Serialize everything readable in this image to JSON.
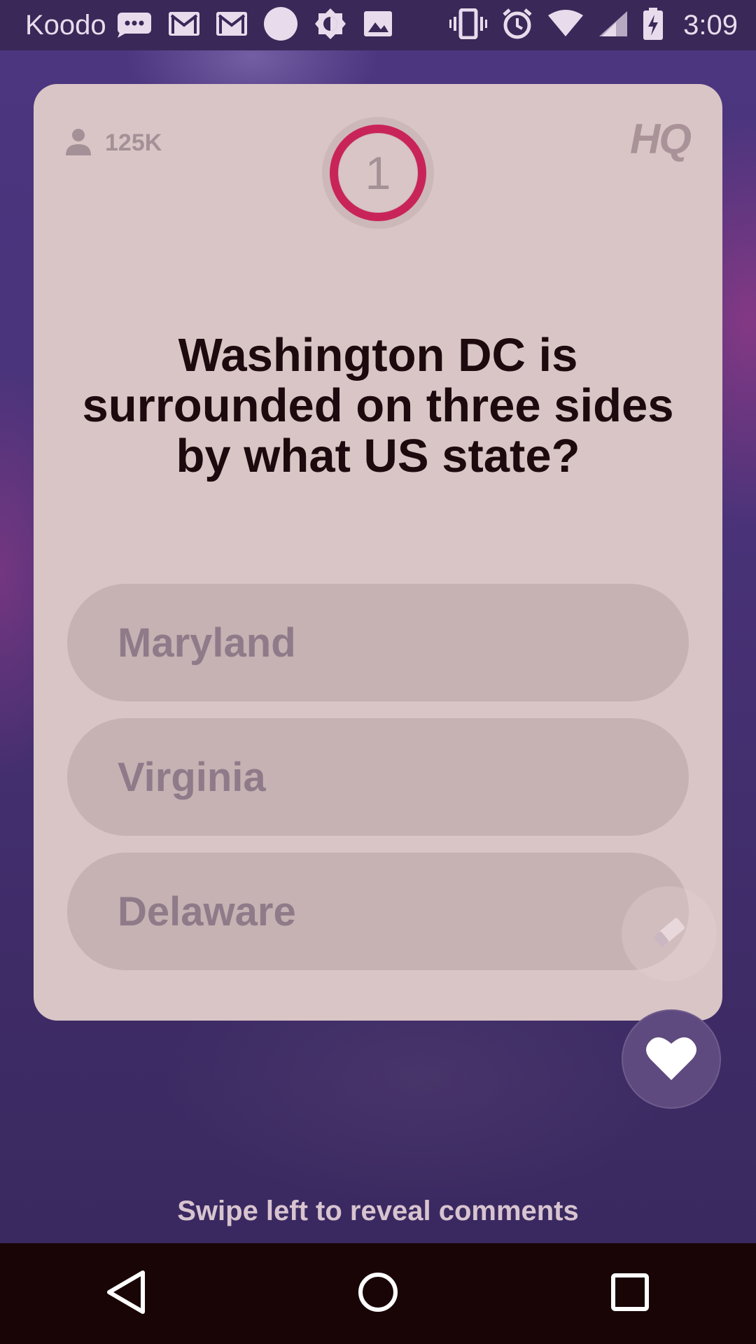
{
  "status_bar": {
    "carrier": "Koodo",
    "time": "3:09",
    "left_icons": [
      "chat-bubble-icon",
      "gmail-icon",
      "gmail-icon",
      "circle-icon",
      "brightness-icon",
      "image-icon"
    ],
    "right_icons": [
      "vibrate-icon",
      "alarm-icon",
      "wifi-icon",
      "signal-icon",
      "battery-charging-icon"
    ]
  },
  "card": {
    "player_count": "125K",
    "logo": "HQ",
    "question_number": "1",
    "question": "Washington DC is surrounded on three sides by what US state?",
    "answers": [
      {
        "label": "Maryland"
      },
      {
        "label": "Virginia"
      },
      {
        "label": "Delaware"
      }
    ]
  },
  "footer": {
    "swipe_hint": "Swipe left to reveal comments"
  },
  "colors": {
    "timer_ring": "#c9245a",
    "card_background": "#d9c5c5",
    "answer_background": "#c6b1b3",
    "question_text": "#1c0a0e"
  },
  "nav_bar": {
    "icons": [
      "back-icon",
      "home-icon",
      "recents-icon"
    ]
  }
}
